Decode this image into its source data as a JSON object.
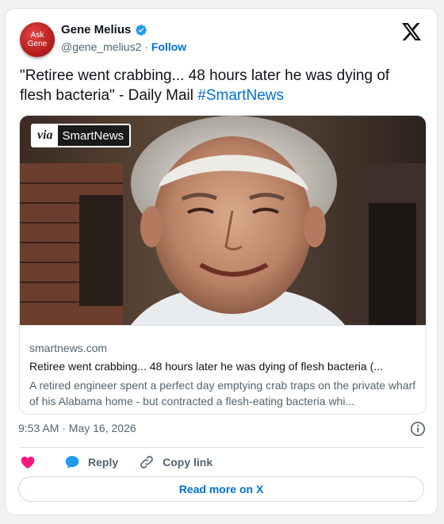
{
  "author": {
    "avatar_text_1": "Ask",
    "avatar_text_2": "Gene",
    "name": "Gene Melius",
    "handle": "@gene_melius2",
    "separator": " · ",
    "follow_label": "Follow"
  },
  "post": {
    "text": "\"Retiree went crabbing... 48 hours later he was dying of flesh bacteria\" - Daily Mail ",
    "hashtag": "#SmartNews",
    "timestamp": "9:53 AM · May 16, 2026"
  },
  "card": {
    "via_label": "via",
    "source_label": "SmartNews",
    "domain": "smartnews.com",
    "title": "Retiree went crabbing... 48 hours later he was dying of flesh bacteria (...",
    "description": "A retired engineer spent a perfect day emptying crab traps on the private wharf of his Alabama home - but contracted a flesh-eating bacteria whi..."
  },
  "actions": {
    "like_icon": "heart-icon",
    "reply_label": "Reply",
    "copy_label": "Copy link",
    "read_more_label": "Read more on X"
  },
  "colors": {
    "accent": "#006fd6",
    "like": "#f91880",
    "reply": "#1d9bf0"
  }
}
